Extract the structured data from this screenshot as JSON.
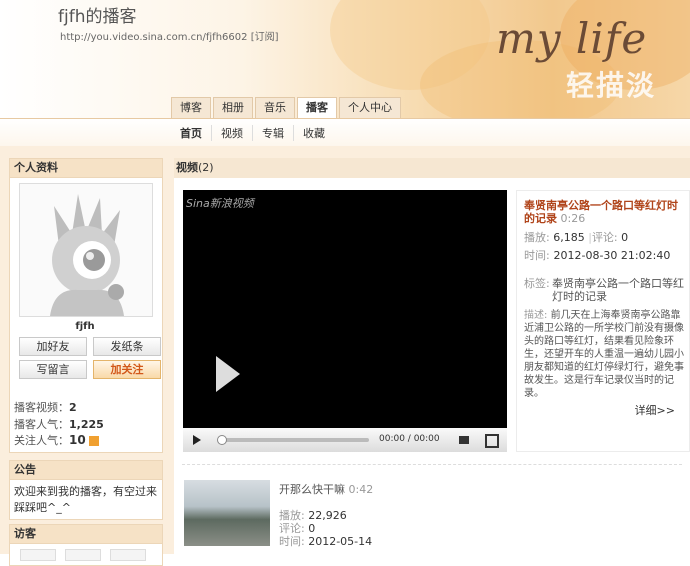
{
  "header": {
    "title": "fjfh的播客",
    "url": "http://you.video.sina.com.cn/fjfh6602",
    "subscribe": "[订阅]",
    "banner_text": "my life",
    "banner_sub": "轻描淡"
  },
  "tabs": [
    "博客",
    "相册",
    "音乐",
    "播客",
    "个人中心"
  ],
  "subnav": [
    "首页",
    "视频",
    "专辑",
    "收藏"
  ],
  "profile": {
    "heading": "个人资料",
    "name": "fjfh",
    "buttons": [
      "加好友",
      "发纸条",
      "写留言",
      "加关注"
    ],
    "stats": [
      {
        "label": "播客视频：",
        "value": "2"
      },
      {
        "label": "播客人气：",
        "value": "1,225"
      },
      {
        "label": "关注人气：",
        "value": "10"
      }
    ]
  },
  "notice": {
    "heading": "公告",
    "text": "欢迎来到我的播客，有空过来踩踩吧^_^"
  },
  "visitors": {
    "heading": "访客"
  },
  "videos": {
    "heading": "视频",
    "count": "(2)"
  },
  "player": {
    "logo": "Sina新浪视频",
    "time": "00:00 / 00:00"
  },
  "video1": {
    "title": "奉贤南亭公路一个路口等红灯时的记录",
    "duration": "0:26",
    "plays_label": "播放:",
    "plays": "6,185",
    "comments_label": "评论:",
    "comments": "0",
    "time_label": "时间:",
    "time": "2012-08-30 21:02:40",
    "tags_label": "标签:",
    "tags": "奉贤南亭公路一个路口等红灯时的记录",
    "desc_label": "描述:",
    "desc": "前几天在上海奉贤南亭公路靠近浦卫公路的一所学校门前没有摄像头的路口等红灯，结果看见险象环生，还望开车的人重温一遍幼儿园小朋友都知道的红灯停绿灯行，避免事故发生。这是行车记录仪当时的记录。",
    "more": "详细>>"
  },
  "video2": {
    "title": "开那么快干嘛",
    "duration": "0:42",
    "plays_label": "播放:",
    "plays": "22,926",
    "comments_label": "评论:",
    "comments": "0",
    "time_label": "时间:",
    "time": "2012-05-14"
  }
}
